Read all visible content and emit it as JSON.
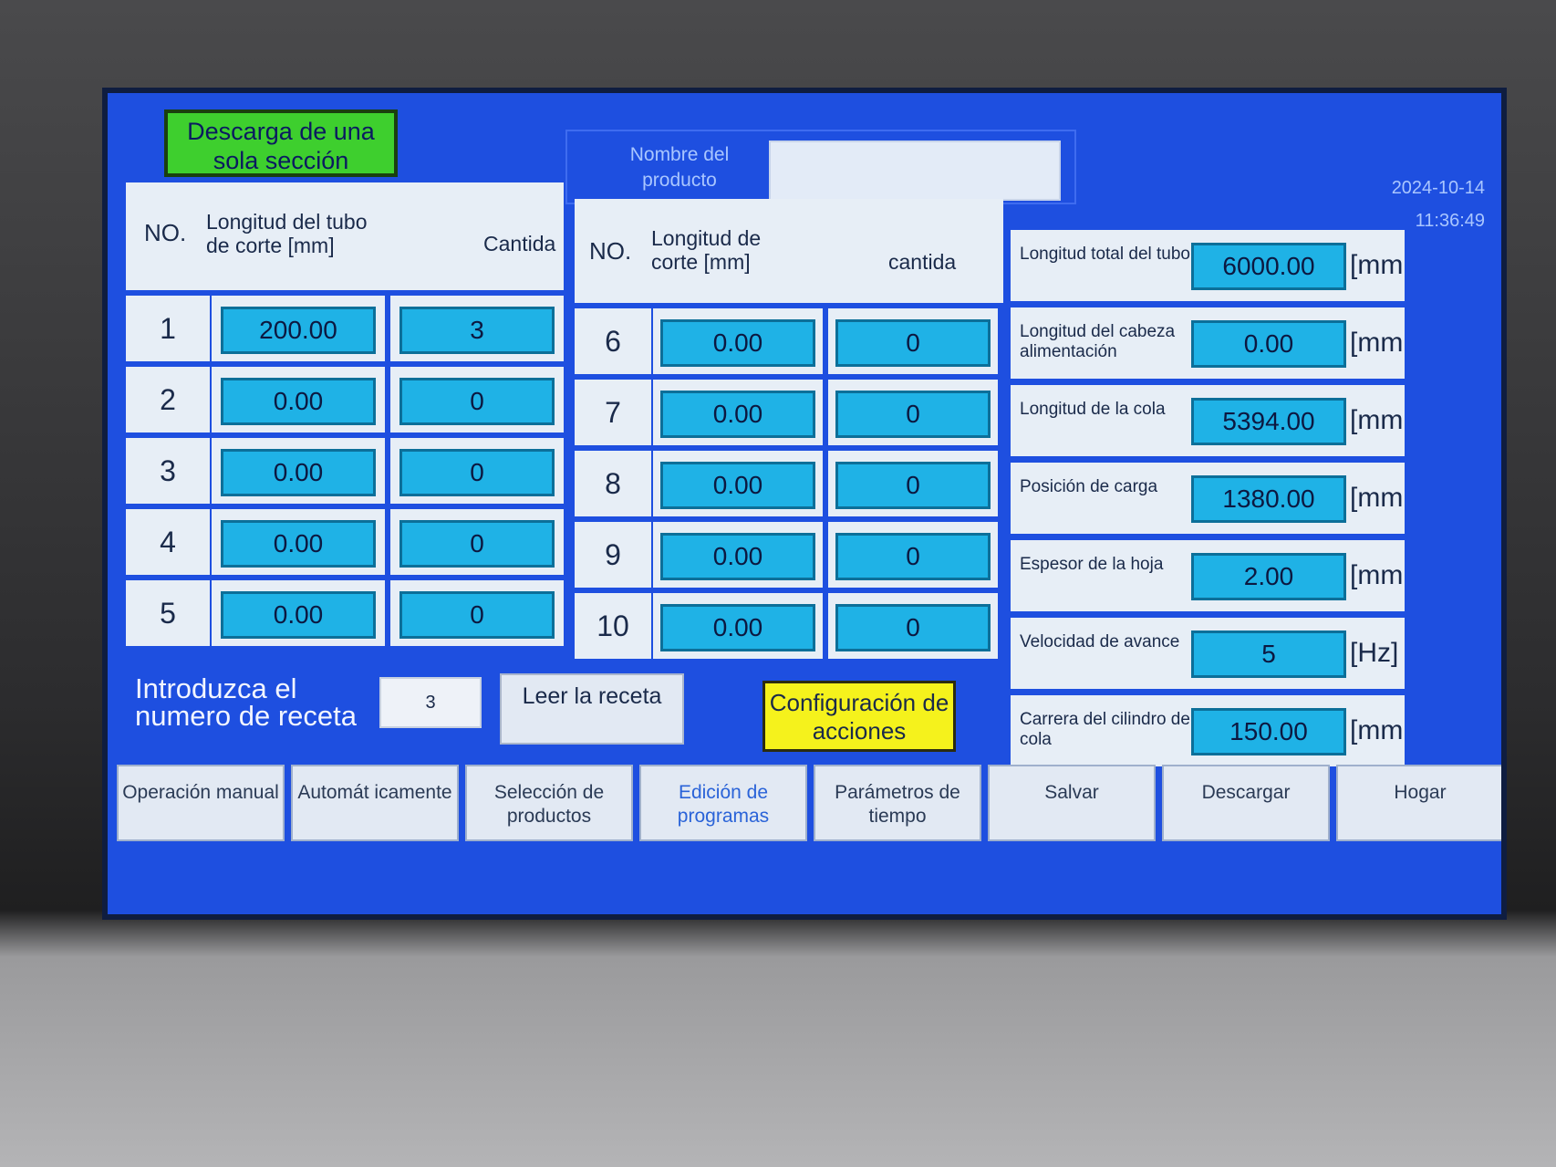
{
  "header": {
    "mode_button": "Descarga de una sola sección",
    "product_name_label": "Nombre del producto",
    "product_name_value": "",
    "date": "2024-10-14",
    "time": "11:36:49"
  },
  "table_left": {
    "col_no": "NO.",
    "col_length": "Longitud del tubo de corte [mm]",
    "col_qty": "Cantida",
    "rows": [
      {
        "no": "1",
        "length": "200.00",
        "qty": "3"
      },
      {
        "no": "2",
        "length": "0.00",
        "qty": "0"
      },
      {
        "no": "3",
        "length": "0.00",
        "qty": "0"
      },
      {
        "no": "4",
        "length": "0.00",
        "qty": "0"
      },
      {
        "no": "5",
        "length": "0.00",
        "qty": "0"
      }
    ]
  },
  "table_right": {
    "col_no": "NO.",
    "col_length": "Longitud de corte [mm]",
    "col_qty": "cantida",
    "rows": [
      {
        "no": "6",
        "length": "0.00",
        "qty": "0"
      },
      {
        "no": "7",
        "length": "0.00",
        "qty": "0"
      },
      {
        "no": "8",
        "length": "0.00",
        "qty": "0"
      },
      {
        "no": "9",
        "length": "0.00",
        "qty": "0"
      },
      {
        "no": "10",
        "length": "0.00",
        "qty": "0"
      }
    ]
  },
  "params": [
    {
      "label": "Longitud total del tubo",
      "value": "6000.00",
      "unit": "[mm"
    },
    {
      "label": "Longitud del cabeza alimentación",
      "value": "0.00",
      "unit": "[mm"
    },
    {
      "label": "Longitud de la cola",
      "value": "5394.00",
      "unit": "[mm"
    },
    {
      "label": "Posición de carga",
      "value": "1380.00",
      "unit": "[mm"
    },
    {
      "label": "Espesor de la hoja",
      "value": "2.00",
      "unit": "[mm"
    },
    {
      "label": "Velocidad de avance",
      "value": "5",
      "unit": "[Hz]"
    },
    {
      "label": "Carrera del cilindro de cola",
      "value": "150.00",
      "unit": "[mm"
    }
  ],
  "recipe": {
    "label": "Introduzca el numero de receta",
    "value": "3",
    "read_button": "Leer la receta",
    "config_button": "Configuración de acciones"
  },
  "nav": [
    {
      "label": "Operación manual"
    },
    {
      "label": "Automát icamente"
    },
    {
      "label": "Selección de productos"
    },
    {
      "label": "Edición de programas"
    },
    {
      "label": "Parámetros de tiempo"
    },
    {
      "label": "Salvar"
    },
    {
      "label": "Descargar"
    },
    {
      "label": "Hogar"
    }
  ],
  "colors": {
    "screen_bg": "#1e4fe0",
    "value_field": "#1fb2e6",
    "mode_button": "#3ecf2e",
    "config_button": "#f5f21c"
  }
}
